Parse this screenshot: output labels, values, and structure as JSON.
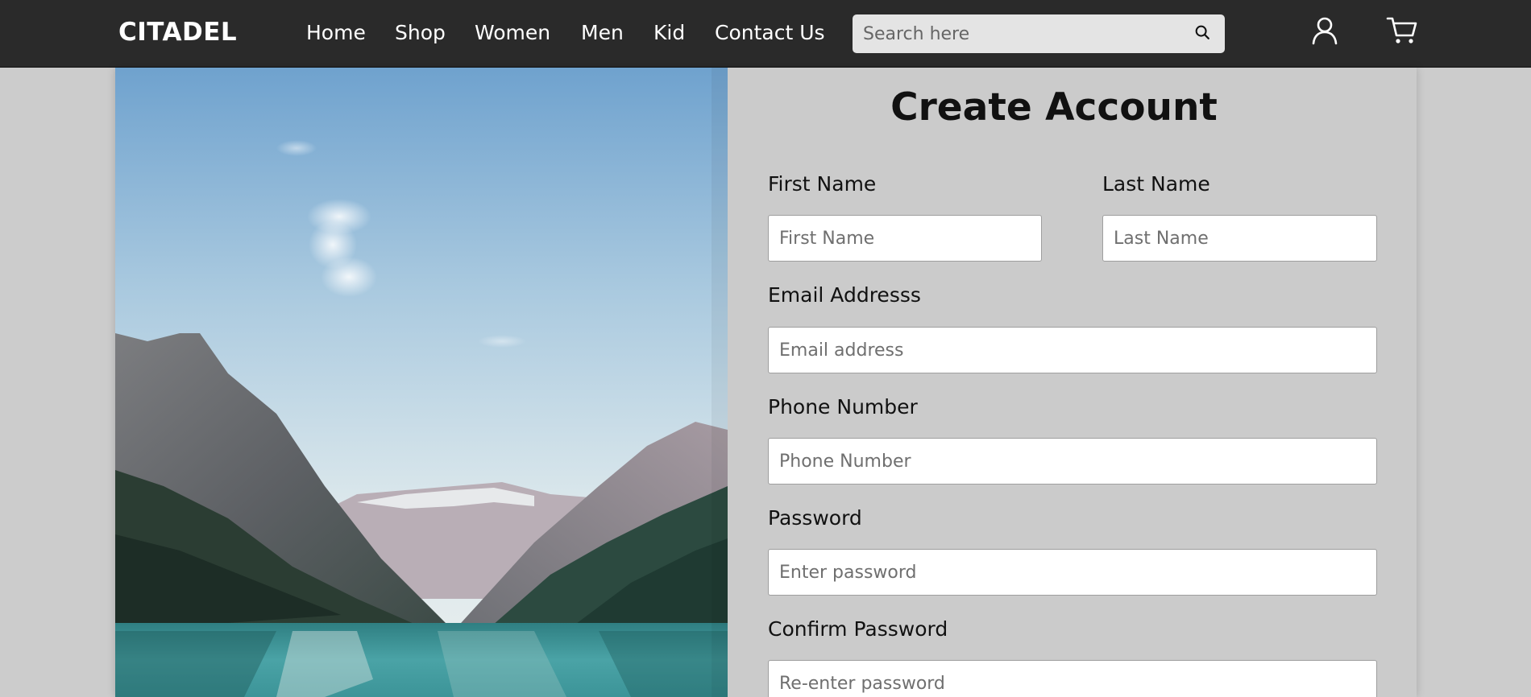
{
  "brand": "CITADEL",
  "nav": {
    "links": [
      "Home",
      "Shop",
      "Women",
      "Men",
      "Kid",
      "Contact Us"
    ]
  },
  "search": {
    "placeholder": "Search here",
    "value": ""
  },
  "icons": {
    "search": "search-icon",
    "account": "user-icon",
    "cart": "cart-icon"
  },
  "colors": {
    "navbar_bg": "#2a2a2a",
    "page_bg": "#cccccc",
    "text": "#111111"
  },
  "form": {
    "title": "Create Account",
    "first_name": {
      "label": "First Name",
      "placeholder": "First Name",
      "value": ""
    },
    "last_name": {
      "label": "Last Name",
      "placeholder": "Last Name",
      "value": ""
    },
    "email": {
      "label": "Email Addresss",
      "placeholder": "Email address",
      "value": ""
    },
    "phone": {
      "label": "Phone Number",
      "placeholder": "Phone Number",
      "value": ""
    },
    "password": {
      "label": "Password",
      "placeholder": "Enter password",
      "value": ""
    },
    "confirm_password": {
      "label": "Confirm Password",
      "placeholder": "Re-enter password",
      "value": ""
    }
  }
}
